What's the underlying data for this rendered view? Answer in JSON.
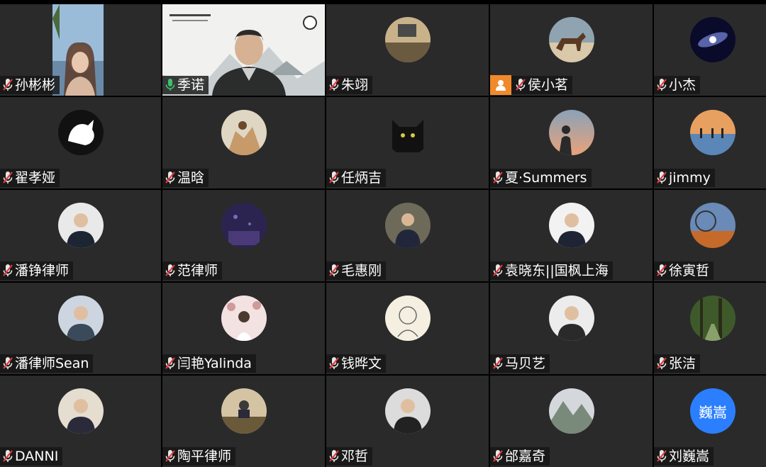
{
  "participants": [
    {
      "name": "孙彬彬",
      "mic": "muted",
      "media": "video-woman"
    },
    {
      "name": "季诺",
      "mic": "active",
      "media": "video-man"
    },
    {
      "name": "朱翊",
      "mic": "muted",
      "media": "avatar-desk",
      "colors": [
        "#6a5a40",
        "#c9b28a"
      ]
    },
    {
      "name": "侯小茗",
      "mic": "muted",
      "media": "avatar-horse",
      "colors": [
        "#8fa3b1",
        "#d9c9a8"
      ],
      "host": true
    },
    {
      "name": "小杰",
      "mic": "muted",
      "media": "avatar-galaxy",
      "colors": [
        "#0a0a2a",
        "#6a7acc"
      ]
    },
    {
      "name": "翟孝娅",
      "mic": "muted",
      "media": "avatar-cat",
      "colors": [
        "#111",
        "#fff"
      ]
    },
    {
      "name": "温晗",
      "mic": "muted",
      "media": "avatar-travel",
      "colors": [
        "#c79a6a",
        "#6a4a2a"
      ]
    },
    {
      "name": "任炳吉",
      "mic": "muted",
      "media": "avatar-blackcat",
      "colors": [
        "#111",
        "#e9e9e9"
      ]
    },
    {
      "name": "夏·Summers",
      "mic": "muted",
      "media": "avatar-sunset",
      "colors": [
        "#2a2a2a",
        "#e8a27a"
      ]
    },
    {
      "name": "jimmy",
      "mic": "muted",
      "media": "avatar-beach",
      "colors": [
        "#e8a060",
        "#5b86b8"
      ]
    },
    {
      "name": "潘铮律师",
      "mic": "muted",
      "media": "avatar-suit",
      "colors": [
        "#e9e9e9",
        "#1d2533"
      ]
    },
    {
      "name": "范律师",
      "mic": "muted",
      "media": "avatar-purple",
      "colors": [
        "#2b2450",
        "#4b3a78"
      ]
    },
    {
      "name": "毛惠刚",
      "mic": "muted",
      "media": "avatar-office",
      "colors": [
        "#6d6a5a",
        "#22263a"
      ]
    },
    {
      "name": "袁晓东||国枫上海",
      "mic": "muted",
      "media": "avatar-suit2",
      "colors": [
        "#f2f2f2",
        "#1e2434"
      ]
    },
    {
      "name": "徐寅哲",
      "mic": "muted",
      "media": "avatar-ferris",
      "colors": [
        "#c56a2a",
        "#6a8ab8"
      ]
    },
    {
      "name": "潘律师Sean",
      "mic": "muted",
      "media": "avatar-glasses",
      "colors": [
        "#cdd6e0",
        "#3a4a5a"
      ]
    },
    {
      "name": "闫艳Yalinda",
      "mic": "muted",
      "media": "avatar-flowers",
      "colors": [
        "#f3e2e2",
        "#b96a6a"
      ]
    },
    {
      "name": "钱晔文",
      "mic": "muted",
      "media": "avatar-sketch",
      "colors": [
        "#f5efe2",
        "#6a6a6a"
      ]
    },
    {
      "name": "马贝艺",
      "mic": "muted",
      "media": "avatar-woman2",
      "colors": [
        "#ececec",
        "#2a2a2a"
      ]
    },
    {
      "name": "张洁",
      "mic": "muted",
      "media": "avatar-forest",
      "colors": [
        "#3e5a2a",
        "#8aa06a"
      ]
    },
    {
      "name": "DANNI",
      "mic": "muted",
      "media": "avatar-woman3",
      "colors": [
        "#e4ddd0",
        "#2a2a3a"
      ]
    },
    {
      "name": "陶平律师",
      "mic": "muted",
      "media": "avatar-meeting",
      "colors": [
        "#6a5a3a",
        "#d4c4a4"
      ]
    },
    {
      "name": "邓哲",
      "mic": "muted",
      "media": "avatar-man3",
      "colors": [
        "#dcdcdc",
        "#222"
      ]
    },
    {
      "name": "邰嘉奇",
      "mic": "muted",
      "media": "avatar-mountain",
      "colors": [
        "#7a8a7a",
        "#d4d8dc"
      ]
    },
    {
      "name": "刘巍嵩",
      "mic": "muted",
      "media": "text-avatar",
      "avatar_text": "巍嵩",
      "colors": [
        "#2b7fff",
        "#ffffff"
      ]
    }
  ]
}
